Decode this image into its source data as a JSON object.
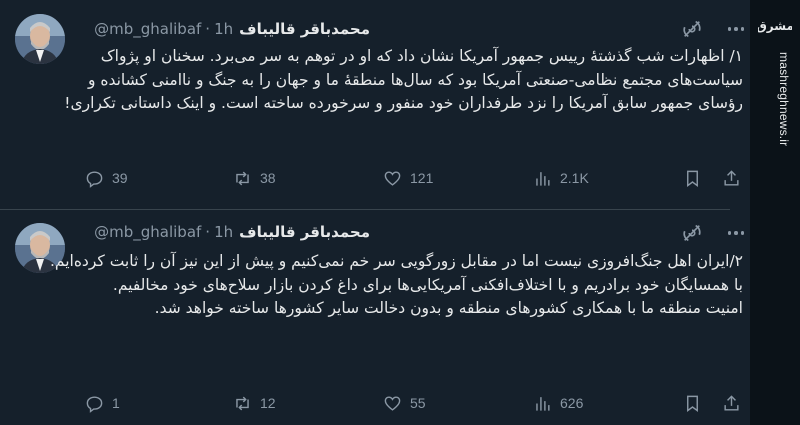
{
  "tweets": [
    {
      "author": {
        "name": "محمدباقر قالیباف",
        "handle": "@mb_ghalibaf",
        "separator": "·",
        "time": "1h"
      },
      "text": [
        "۱/ اظهارات شب گذشتهٔ رییس جمهور آمریکا  نشان داد که او در توهم به سر می‌برد. سخنان او پژواک سیاست‌های مجتمع نظامی-صنعتی آمریکا بود که سال‌ها منطقهٔ ما و جهان را به جنگ و ناامنی کشانده و رؤسای جمهور سابق آمریکا را نزد طرفداران خود منفور و سرخورده ساخته است. و اینک داستانی تکراری!"
      ],
      "stats": {
        "replies": "39",
        "reposts": "38",
        "likes": "121",
        "views": "2.1K"
      }
    },
    {
      "author": {
        "name": "محمدباقر قالیباف",
        "handle": "@mb_ghalibaf",
        "separator": "·",
        "time": "1h"
      },
      "text": [
        "۲/ایران اهل جنگ‌افروزی نیست اما در مقابل زورگویی سر خم نمی‌کنیم و پیش از این نیز آن را ثابت کرده‌ایم. با همسایگان خود برادریم و با اختلاف‌افکنی آمریکایی‌ها برای داغ کردن بازار سلاح‌های خود مخالفیم.",
        "امنیت منطقه ما با همکاری کشورهای منطقه و بدون دخالت سایر کشورها ساخته خواهد شد."
      ],
      "stats": {
        "replies": "1",
        "reposts": "12",
        "likes": "55",
        "views": "626"
      }
    }
  ],
  "watermark": {
    "logo_text": "مشرق",
    "url": "mashreghnews.ir"
  },
  "icons": [
    "grok-icon",
    "more-icon",
    "reply-icon",
    "repost-icon",
    "like-icon",
    "views-icon",
    "bookmark-icon",
    "share-icon"
  ],
  "colors": {
    "background": "#15202b",
    "text": "#e7e9ea",
    "muted": "#8b98a5",
    "divider": "#38444d"
  }
}
